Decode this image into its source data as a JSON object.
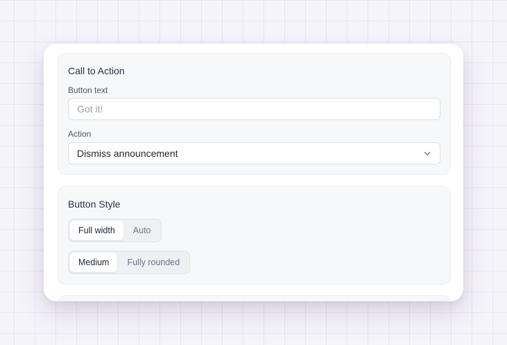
{
  "cta": {
    "title": "Call to Action",
    "button_text_label": "Button text",
    "button_text_placeholder": "Got it!",
    "button_text_value": "",
    "action_label": "Action",
    "action_value": "Dismiss announcement"
  },
  "button_style": {
    "title": "Button Style",
    "width_options": [
      {
        "label": "Full width",
        "selected": true
      },
      {
        "label": "Auto",
        "selected": false
      }
    ],
    "shape_options": [
      {
        "label": "Medium",
        "selected": true
      },
      {
        "label": "Fully rounded",
        "selected": false
      }
    ]
  },
  "icons": {
    "select_chevron": "chevron-down-icon"
  },
  "colors": {
    "background": "#f6f4fb",
    "card": "#ffffff",
    "section": "#f7f8fa",
    "text": "#1f2430",
    "muted": "#6b7280"
  }
}
